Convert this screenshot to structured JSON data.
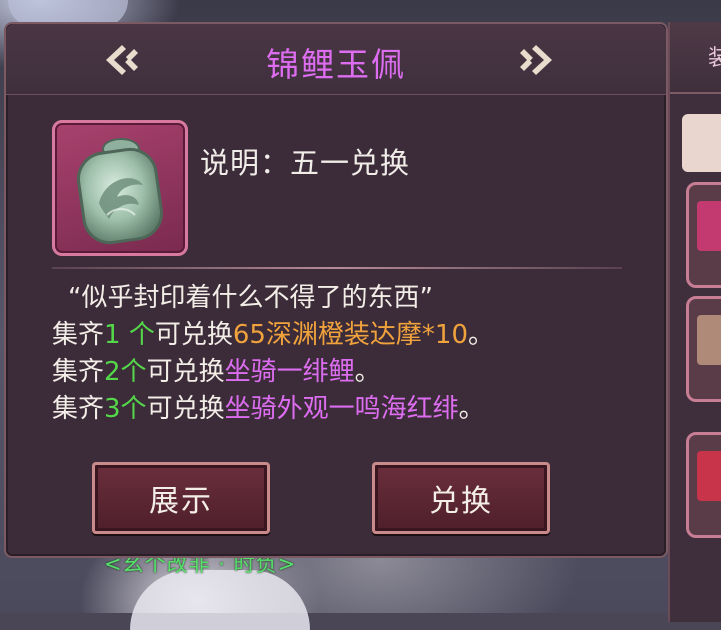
{
  "background": {
    "under_name": "<幺个改非 · 时负>"
  },
  "side_panel": {
    "header_char": "装"
  },
  "dialog": {
    "title": "锦鲤玉佩",
    "description": "说明：五一兑换",
    "flavor": "“似乎封印着什么不得了的东西”",
    "rewards": [
      {
        "prefix": "集齐",
        "count": "1 个",
        "mid": "可兑换",
        "reward": "65深渊橙装达摩*10",
        "suffix": "。",
        "reward_color": "orange"
      },
      {
        "prefix": "集齐",
        "count": "2个",
        "mid": "可兑换",
        "reward": "坐骑一绯鲤",
        "suffix": "。",
        "reward_color": "purple"
      },
      {
        "prefix": "集齐",
        "count": "3个",
        "mid": "可兑换",
        "reward": "坐骑外观一鸣海红绯",
        "suffix": "。",
        "reward_color": "purple"
      }
    ],
    "buttons": {
      "show": "展示",
      "exchange": "兑换"
    },
    "icons": {
      "prev": "chevron-left-icon",
      "next": "chevron-right-icon",
      "item": "jade-pendant-icon"
    }
  },
  "colors": {
    "title": "#dd6df0",
    "count": "#54d84a",
    "orange_reward": "#f0a23c",
    "purple_reward": "#dd6df0"
  }
}
